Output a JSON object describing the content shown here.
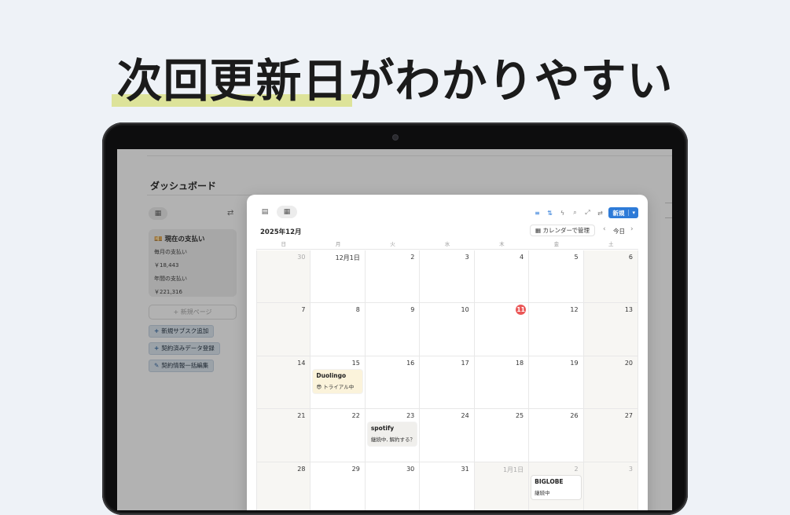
{
  "headline": {
    "highlighted": "次回更新日",
    "rest": "がわかりやすい",
    "highlight_color": "#dde39a"
  },
  "background_page": {
    "title": "ダッシュボード",
    "view_icon": "grid-icon",
    "current_payment": {
      "title": "現在の支払い",
      "monthly_label": "毎月の支払い",
      "monthly_value": "￥18,443",
      "yearly_label": "年間の支払い",
      "yearly_value": "￥221,316"
    },
    "new_page_label": "+ 新規ページ",
    "buttons": [
      {
        "icon": "+",
        "label": "新規サブスク追加"
      },
      {
        "icon": "+",
        "label": "契約済みデータ登録"
      },
      {
        "icon": "✎",
        "label": "契約情報一括編集"
      }
    ]
  },
  "calendar": {
    "accent_color": "#2e7bd8",
    "today_color": "#eb5757",
    "month_title": "2025年12月",
    "manage_label": "カレンダーで管理",
    "today_label": "今日",
    "new_label": "新規",
    "weekdays": [
      "日",
      "月",
      "火",
      "水",
      "木",
      "金",
      "土"
    ],
    "weeks": [
      [
        {
          "label": "30",
          "muted": true,
          "shade": true
        },
        {
          "label": "12月1日"
        },
        {
          "label": "2"
        },
        {
          "label": "3"
        },
        {
          "label": "4"
        },
        {
          "label": "5"
        },
        {
          "label": "6",
          "shade": true
        }
      ],
      [
        {
          "label": "7",
          "shade": true
        },
        {
          "label": "8"
        },
        {
          "label": "9"
        },
        {
          "label": "10"
        },
        {
          "label": "11",
          "today": true
        },
        {
          "label": "12"
        },
        {
          "label": "13",
          "shade": true
        }
      ],
      [
        {
          "label": "14",
          "shade": true
        },
        {
          "label": "15",
          "event": {
            "title": "Duolingo",
            "sub": "😎 トライアル中",
            "style": "yellow"
          }
        },
        {
          "label": "16"
        },
        {
          "label": "17"
        },
        {
          "label": "18"
        },
        {
          "label": "19"
        },
        {
          "label": "20",
          "shade": true
        }
      ],
      [
        {
          "label": "21",
          "shade": true
        },
        {
          "label": "22"
        },
        {
          "label": "23",
          "event": {
            "title": "spotify",
            "sub": "継続中, 解約する？",
            "style": "gray"
          }
        },
        {
          "label": "24"
        },
        {
          "label": "25"
        },
        {
          "label": "26"
        },
        {
          "label": "27",
          "shade": true
        }
      ],
      [
        {
          "label": "28",
          "shade": true
        },
        {
          "label": "29"
        },
        {
          "label": "30"
        },
        {
          "label": "31"
        },
        {
          "label": "1月1日",
          "muted": true,
          "shade": true
        },
        {
          "label": "2",
          "muted": true,
          "shade": true,
          "event": {
            "title": "BIGLOBE",
            "sub": "継続中",
            "style": "white"
          }
        },
        {
          "label": "3",
          "muted": true,
          "shade": true
        }
      ]
    ]
  }
}
